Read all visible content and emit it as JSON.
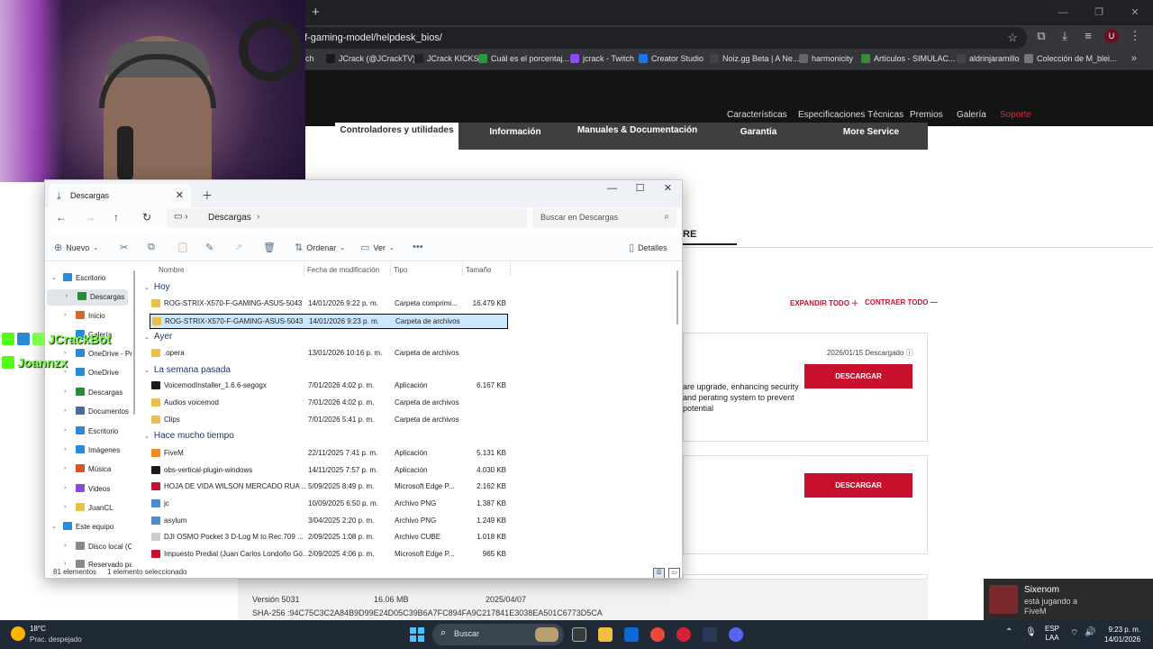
{
  "browser": {
    "url": "f-gaming-model/helpdesk_bios/",
    "new_tab": "+",
    "bookmarks": [
      "ch",
      "JCrack (@JCrackTV)...",
      "JCrack KICKS",
      "Cuál es el porcentaj...",
      "jcrack - Twitch",
      "Creator Studio",
      "Noiz.gg Beta | A Ne...",
      "harmonicity",
      "Artículos - SIMULAC...",
      "aldrinjaramillo",
      "Colección de M_blei..."
    ]
  },
  "page": {
    "nav_links": [
      "Características",
      "Especificaciones Técnicas",
      "Premios",
      "Galería",
      "Soporte"
    ],
    "tabs": [
      "Controladores y utilidades",
      "Información",
      "Manuales & Documentación",
      "Garantía",
      "More Service"
    ],
    "partial_heading": "RE",
    "expand_all": "EXPANDIR TODO",
    "collapse_all": "CONTRAER TODO",
    "card_date": "2026/01/15",
    "card_downloaded": "Descargado",
    "card_text": "are upgrade, enhancing security and perating system to prevent potential",
    "download_label": "DESCARGAR",
    "version_label": "Versión 5031",
    "version_size": "16.06 MB",
    "version_date": "2025/04/07",
    "sha": "SHA-256 :94C75C3C2A84B9D99E24D05C39B6A7FC894FA9C217841E3038EA501C6773D5CA"
  },
  "overlay": {
    "chat": [
      {
        "user": "JCrackBot",
        "color": "#7cff4a"
      },
      {
        "user": "Joannzx",
        "color": "#7cff4a"
      }
    ],
    "notification": {
      "name": "Sixenom",
      "status": "está jugando a",
      "game": "FiveM"
    }
  },
  "explorer": {
    "tab_title": "Descargas",
    "breadcrumb": "Descargas",
    "search_placeholder": "Buscar en Descargas",
    "commands": {
      "new": "Nuevo",
      "sort": "Ordenar",
      "view": "Ver",
      "details": "Detalles"
    },
    "columns": {
      "name": "Nombre",
      "date": "Fecha de modificación",
      "type": "Tipo",
      "size": "Tamaño"
    },
    "nav_items": [
      {
        "label": "Escritorio",
        "color": "#2a8ad8"
      },
      {
        "label": "Descargas",
        "color": "#2a8a3a"
      },
      {
        "label": "Inicio",
        "color": "#d46a2a"
      },
      {
        "label": "Galería",
        "color": "#2a8ad8"
      },
      {
        "label": "OneDrive - Per",
        "color": "#2a8ad8"
      },
      {
        "label": "OneDrive",
        "color": "#2a8ad8"
      },
      {
        "label": "Descargas",
        "color": "#2a8a3a"
      },
      {
        "label": "Documentos",
        "color": "#4a6a9a"
      },
      {
        "label": "Escritorio",
        "color": "#2a8ad8"
      },
      {
        "label": "Imágenes",
        "color": "#2a8ad8"
      },
      {
        "label": "Música",
        "color": "#d4542a"
      },
      {
        "label": "Videos",
        "color": "#8a4ad8"
      },
      {
        "label": "JuanCL",
        "color": "#e8c04a"
      },
      {
        "label": "Este equipo",
        "color": "#2a8ad8"
      },
      {
        "label": "Disco local (C",
        "color": "#888888"
      },
      {
        "label": "Reservado pa",
        "color": "#888888"
      }
    ],
    "groups": {
      "today": "Hoy",
      "yesterday": "Ayer",
      "last_week": "La semana pasada",
      "long_ago": "Hace mucho tiempo"
    },
    "files": [
      {
        "name": "ROG-STRIX-X570-F-GAMING-ASUS-5043",
        "date": "14/01/2026 9:22 p. m.",
        "type": "Carpeta comprimi...",
        "size": "16.479 KB",
        "icon": "#e8c04a"
      },
      {
        "name": "ROG-STRIX-X570-F-GAMING-ASUS-5043",
        "date": "14/01/2026 9:23 p. m.",
        "type": "Carpeta de archivos",
        "size": "",
        "icon": "#e8c04a"
      },
      {
        "name": ".opera",
        "date": "13/01/2026 10:16 p. m.",
        "type": "Carpeta de archivos",
        "size": "",
        "icon": "#e8c04a"
      },
      {
        "name": "VoicemodInstaller_1.6.6-segogx",
        "date": "7/01/2026 4:02 p. m.",
        "type": "Aplicación",
        "size": "6.167 KB",
        "icon": "#1a1a1a"
      },
      {
        "name": "Audios voicemod",
        "date": "7/01/2026 4:02 p. m.",
        "type": "Carpeta de archivos",
        "size": "",
        "icon": "#e8c04a"
      },
      {
        "name": "Clips",
        "date": "7/01/2026 5:41 p. m.",
        "type": "Carpeta de archivos",
        "size": "",
        "icon": "#e8c04a"
      },
      {
        "name": "FiveM",
        "date": "22/11/2025 7:41 p. m.",
        "type": "Aplicación",
        "size": "5.131 KB",
        "icon": "#f08a24"
      },
      {
        "name": "obs-vertical-plugin-windows",
        "date": "14/11/2025 7:57 p. m.",
        "type": "Aplicación",
        "size": "4.030 KB",
        "icon": "#1a1a1a"
      },
      {
        "name": "HOJA DE VIDA WILSON MERCADO RUA ...",
        "date": "5/09/2025 8:49 p. m.",
        "type": "Microsoft Edge P...",
        "size": "2.162 KB",
        "icon": "#c8102e"
      },
      {
        "name": "jc",
        "date": "10/09/2025 6:50 p. m.",
        "type": "Archivo PNG",
        "size": "1.387 KB",
        "icon": "#4a8ad8"
      },
      {
        "name": "asylum",
        "date": "3/04/2025 2:20 p. m.",
        "type": "Archivo PNG",
        "size": "1.249 KB",
        "icon": "#4a8ad8"
      },
      {
        "name": "DJI OSMO Pocket 3 D-Log M to Rec.709 ...",
        "date": "2/09/2025 1:08 p. m.",
        "type": "Archivo CUBE",
        "size": "1.018 KB",
        "icon": "#cccccc"
      },
      {
        "name": "Impuesto Predial (Juan Carlos Londoño Gó...",
        "date": "2/09/2025 4:06 p. m.",
        "type": "Microsoft Edge P...",
        "size": "965 KB",
        "icon": "#c8102e"
      }
    ],
    "status": {
      "count": "81 elementos",
      "selected": "1 elemento seleccionado"
    }
  },
  "taskbar": {
    "temp": "18°C",
    "weather": "Prac. despejado",
    "search": "Buscar",
    "lang1": "ESP",
    "lang2": "LAA",
    "time": "9:23 p. m.",
    "date": "14/01/2026"
  }
}
